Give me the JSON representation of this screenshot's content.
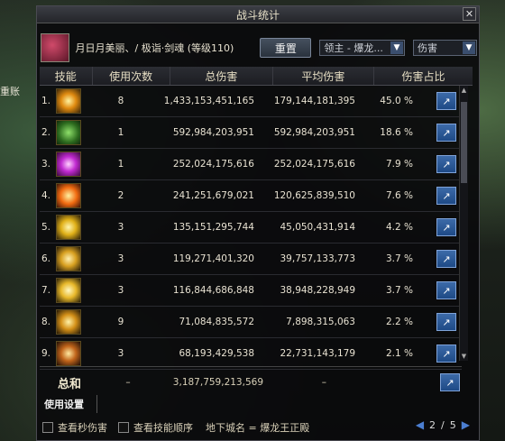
{
  "background": {
    "side_text": "重账"
  },
  "window": {
    "title": "战斗统计",
    "close_label": "✕"
  },
  "header": {
    "player_name": "月日月美丽、/ 极诣·剑魂 (等级110)",
    "reset_label": "重置",
    "target_select": "领主 - 爆龙...",
    "mode_select": "伤害"
  },
  "columns": [
    "技能",
    "使用次数",
    "总伤害",
    "平均伤害",
    "伤害占比"
  ],
  "rows": [
    {
      "idx": "1.",
      "uses": "8",
      "total": "1,433,153,451,165",
      "avg": "179,144,181,395",
      "pct": "45.0 %"
    },
    {
      "idx": "2.",
      "uses": "1",
      "total": "592,984,203,951",
      "avg": "592,984,203,951",
      "pct": "18.6 %"
    },
    {
      "idx": "3.",
      "uses": "1",
      "total": "252,024,175,616",
      "avg": "252,024,175,616",
      "pct": "7.9 %"
    },
    {
      "idx": "4.",
      "uses": "2",
      "total": "241,251,679,021",
      "avg": "120,625,839,510",
      "pct": "7.6 %"
    },
    {
      "idx": "5.",
      "uses": "3",
      "total": "135,151,295,744",
      "avg": "45,050,431,914",
      "pct": "4.2 %"
    },
    {
      "idx": "6.",
      "uses": "3",
      "total": "119,271,401,320",
      "avg": "39,757,133,773",
      "pct": "3.7 %"
    },
    {
      "idx": "7.",
      "uses": "3",
      "total": "116,844,686,848",
      "avg": "38,948,228,949",
      "pct": "3.7 %"
    },
    {
      "idx": "8.",
      "uses": "9",
      "total": "71,084,835,572",
      "avg": "7,898,315,063",
      "pct": "2.2 %"
    },
    {
      "idx": "9.",
      "uses": "3",
      "total": "68,193,429,538",
      "avg": "22,731,143,179",
      "pct": "2.1 %"
    }
  ],
  "total_row": {
    "label": "总和",
    "uses": "–",
    "total": "3,187,759,213,569",
    "avg": "–"
  },
  "settings_label": "使用设置",
  "bottom": {
    "checkbox_dps": "查看秒伤害",
    "checkbox_order": "查看技能顺序",
    "dungeon": "地下城名 = 爆龙王正殿",
    "page_current": "2",
    "page_sep": "/",
    "page_total": "5"
  },
  "colors": {
    "accent_blue": "#3c6aa8",
    "text_gold": "#e4dcc2"
  }
}
